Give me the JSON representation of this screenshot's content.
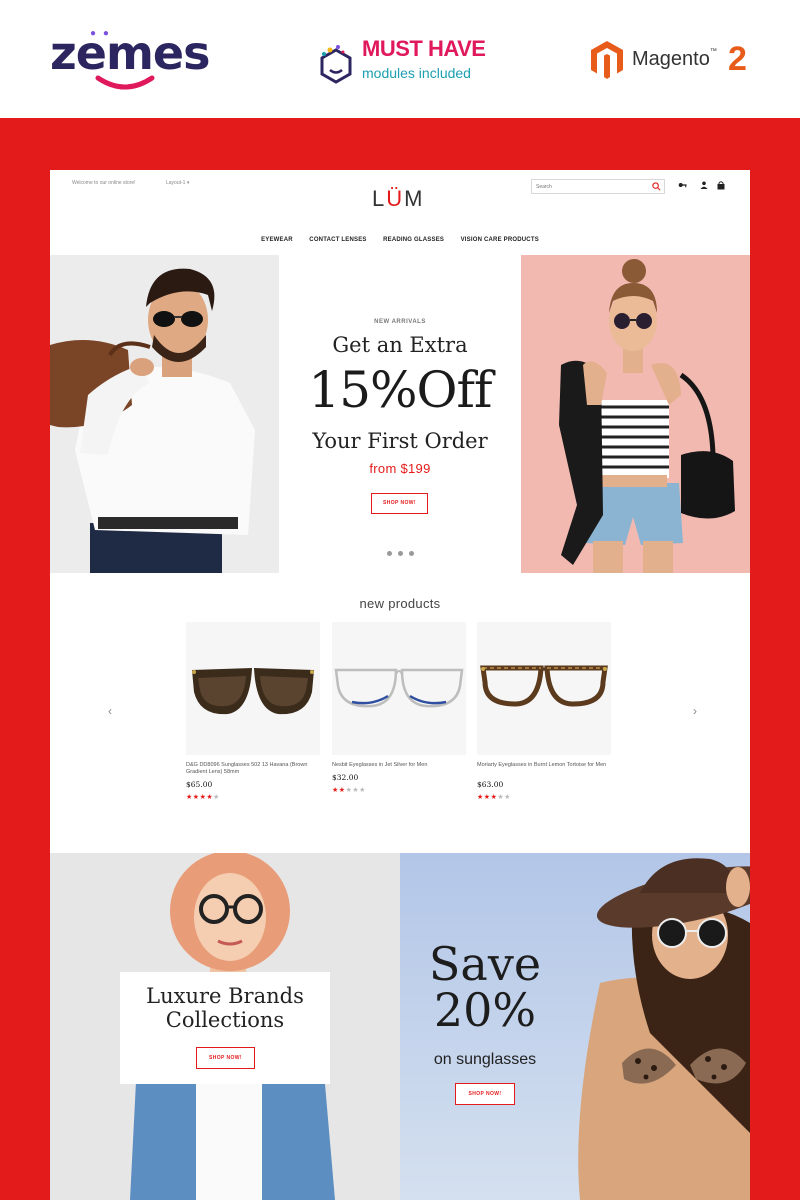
{
  "promo": {
    "brand": "zemes",
    "musthave_title": "MUST HAVE",
    "musthave_sub": "modules included",
    "platform_name": "Magento",
    "platform_tm": "™",
    "platform_version": "2"
  },
  "store": {
    "welcome": "Welcome to our online store!",
    "layout_link": "Layout-1 ▾",
    "logo_l": "L",
    "logo_u": "Ü",
    "logo_m": "M",
    "search_placeholder": "Search",
    "nav": [
      "EYEWEAR",
      "CONTACT LENSES",
      "READING GLASSES",
      "VISION CARE PRODUCTS"
    ]
  },
  "hero": {
    "eyebrow": "NEW ARRIVALS",
    "line1": "Get an Extra",
    "line2": "15%Off",
    "line3": "Your First Order",
    "price": "from $199",
    "button": "SHOP NOW!"
  },
  "new_products": {
    "title": "new products",
    "prev": "‹",
    "next": "›",
    "items": [
      {
        "name": "D&G DD8096 Sunglasses 502 13 Havana (Brown Gradient Lens) 58mm",
        "price": "$65.00",
        "rating": 4
      },
      {
        "name": "Nesbit Eyeglasses in Jet Silver for Men",
        "price": "$32.00",
        "rating": 2
      },
      {
        "name": "Moriarty Eyeglasses in Burnt Lemon Tortoise for Men",
        "price": "$63.00",
        "rating": 3
      }
    ]
  },
  "banners": {
    "left_title_1": "Luxure Brands",
    "left_title_2": "Collections",
    "left_button": "SHOP NOW!",
    "right_title_1": "Save",
    "right_title_2": "20%",
    "right_sub": "on sunglasses",
    "right_button": "SHOP NOW!"
  },
  "colors": {
    "accent": "#e41b1b",
    "frame": "#e41b1b",
    "musthave": "#e0185c",
    "magento": "#e85c1b"
  }
}
